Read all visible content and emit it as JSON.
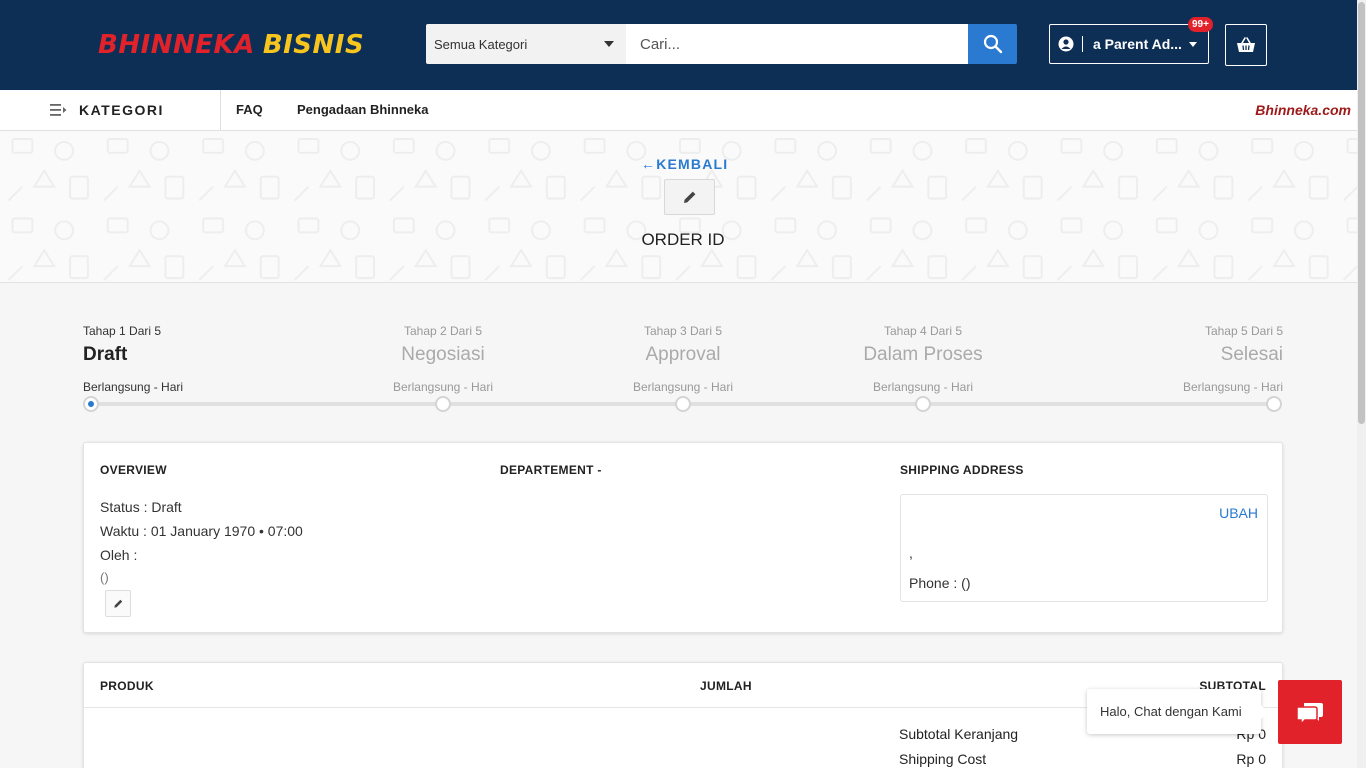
{
  "header": {
    "logo_part1": "BHINNEKA",
    "logo_part2": "BISNIS",
    "category_select": "Semua Kategori",
    "search_placeholder": "Cari...",
    "account_name": "a Parent Ad...",
    "notif_badge": "99+"
  },
  "nav": {
    "kategori_label": "KATEGORI",
    "links": [
      "FAQ",
      "Pengadaan Bhinneka"
    ],
    "brand_link": "Bhinneka.com"
  },
  "banner": {
    "back_label": "KEMBALI",
    "order_title": "ORDER ID"
  },
  "stepper": {
    "steps": [
      {
        "stage": "Tahap 1 Dari 5",
        "name": "Draft",
        "duration": "Berlangsung - Hari",
        "active": true
      },
      {
        "stage": "Tahap 2 Dari 5",
        "name": "Negosiasi",
        "duration": "Berlangsung - Hari",
        "active": false
      },
      {
        "stage": "Tahap 3 Dari 5",
        "name": "Approval",
        "duration": "Berlangsung - Hari",
        "active": false
      },
      {
        "stage": "Tahap 4 Dari 5",
        "name": "Dalam Proses",
        "duration": "Berlangsung - Hari",
        "active": false
      },
      {
        "stage": "Tahap 5 Dari 5",
        "name": "Selesai",
        "duration": "Berlangsung - Hari",
        "active": false
      }
    ]
  },
  "overview": {
    "title": "OVERVIEW",
    "status": "Status : Draft",
    "waktu": "Waktu : 01 January 1970 • 07:00",
    "oleh": "Oleh :",
    "paren": "()",
    "department_title": "DEPARTEMENT -",
    "shipping_title": "SHIPPING ADDRESS",
    "ubah_label": "UBAH",
    "address_line": ",",
    "phone": "Phone : ()"
  },
  "products": {
    "col_produk": "PRODUK",
    "col_jumlah": "JUMLAH",
    "col_subtotal": "SUBTOTAL",
    "subtotal_label": "Subtotal Keranjang",
    "subtotal_value": "Rp 0",
    "shipping_label": "Shipping Cost",
    "shipping_value": "Rp 0"
  },
  "chat": {
    "bubble_text": "Halo, Chat dengan Kami"
  },
  "colors": {
    "header_bg": "#0d2f55",
    "accent_blue": "#2a7ad2",
    "brand_red": "#e2222b",
    "logo_yellow": "#f7c51e"
  }
}
